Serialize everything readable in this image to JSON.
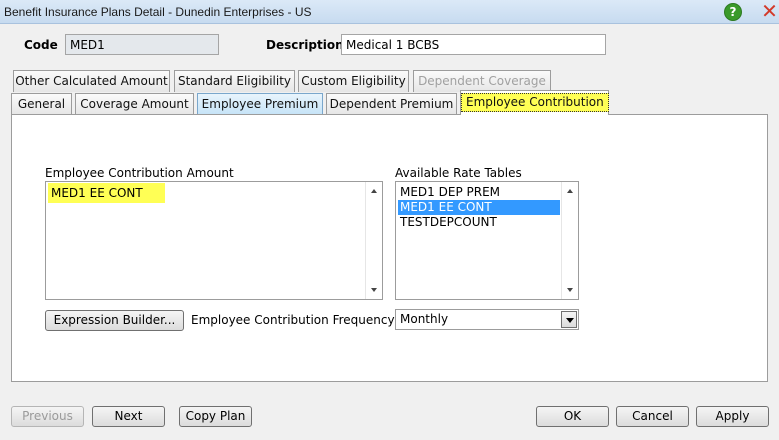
{
  "window": {
    "title": "Benefit Insurance Plans Detail - Dunedin Enterprises - US",
    "help_glyph": "?",
    "close_glyph": "✕"
  },
  "header": {
    "code_label": "Code",
    "code_value": "MED1",
    "description_label": "Description",
    "description_value": "Medical 1 BCBS"
  },
  "tabs_row1": [
    {
      "label": "Other Calculated Amount"
    },
    {
      "label": "Standard Eligibility"
    },
    {
      "label": "Custom Eligibility"
    },
    {
      "label": "Dependent Coverage"
    }
  ],
  "tabs_row2": [
    {
      "label": "General"
    },
    {
      "label": "Coverage Amount"
    },
    {
      "label": "Employee Premium"
    },
    {
      "label": "Dependent Premium"
    },
    {
      "label": "Employee Contribution"
    }
  ],
  "panel": {
    "contribution_amount_label": "Employee Contribution Amount",
    "contribution_amount_value": "MED1 EE CONT",
    "rate_tables_label": "Available Rate Tables",
    "rate_tables": [
      "MED1 DEP PREM",
      "MED1 EE CONT",
      "TESTDEPCOUNT"
    ],
    "rate_tables_selected": "MED1 EE CONT",
    "expression_builder_label": "Expression Builder...",
    "frequency_label": "Employee Contribution Frequency",
    "frequency_value": "Monthly"
  },
  "footer": {
    "previous": "Previous",
    "next": "Next",
    "copy_plan": "Copy Plan",
    "ok": "OK",
    "cancel": "Cancel",
    "apply": "Apply"
  },
  "colors": {
    "highlight": "#ffff55",
    "selection": "#3399ff",
    "hover_tab": "#c5e3f7"
  }
}
